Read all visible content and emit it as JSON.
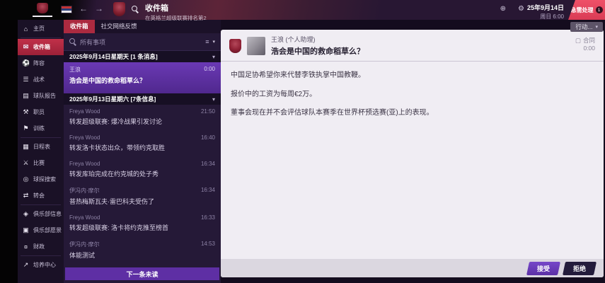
{
  "topbar": {
    "back": "←",
    "forward": "→",
    "title": "收件箱",
    "subtitle": "在英格兰超级联赛排名第2",
    "world_glyph": "⊕",
    "gear_glyph": "⚙",
    "date_line1": "25年9月14日",
    "date_line2": "周日 6:00",
    "urgent": {
      "label": "急需处理",
      "count": "1"
    },
    "actions": "行动...",
    "caret": "▾"
  },
  "sidebar": {
    "items": [
      {
        "key": "home",
        "label": "主页",
        "glyph": "⌂",
        "group": 0,
        "selected": false
      },
      {
        "key": "inbox",
        "label": "收件箱",
        "glyph": "✉",
        "group": 1,
        "selected": true
      },
      {
        "key": "squad",
        "label": "阵容",
        "glyph": "⚽",
        "group": 1,
        "selected": false
      },
      {
        "key": "tactics",
        "label": "战术",
        "glyph": "☰",
        "group": 1,
        "selected": false
      },
      {
        "key": "team-report",
        "label": "球队报告",
        "glyph": "▤",
        "group": 1,
        "selected": false
      },
      {
        "key": "staff",
        "label": "职员",
        "glyph": "⚒",
        "group": 1,
        "selected": false
      },
      {
        "key": "training",
        "label": "训练",
        "glyph": "⚑",
        "group": 1,
        "selected": false
      },
      {
        "key": "schedule",
        "label": "日程表",
        "glyph": "▦",
        "group": 2,
        "selected": false
      },
      {
        "key": "competitions",
        "label": "比赛",
        "glyph": "⚔",
        "group": 2,
        "selected": false
      },
      {
        "key": "scouting",
        "label": "球探搜索",
        "glyph": "◎",
        "group": 2,
        "selected": false
      },
      {
        "key": "transfers",
        "label": "转会",
        "glyph": "⇄",
        "group": 2,
        "selected": false
      },
      {
        "key": "club-info",
        "label": "俱乐部信息",
        "glyph": "◈",
        "group": 3,
        "selected": false
      },
      {
        "key": "club-vision",
        "label": "俱乐部愿景",
        "glyph": "▣",
        "group": 3,
        "selected": false
      },
      {
        "key": "finances",
        "label": "财政",
        "glyph": "¤",
        "group": 3,
        "selected": false
      },
      {
        "key": "development-centre",
        "label": "培养中心",
        "glyph": "↗",
        "group": 4,
        "selected": false
      }
    ]
  },
  "mail": {
    "tabs": [
      {
        "key": "inbox",
        "label": "收件箱",
        "active": true
      },
      {
        "key": "social",
        "label": "社交网络反馈",
        "active": false
      }
    ],
    "search_label": "所有事项",
    "view_glyph": "≡",
    "caret": "▾",
    "sections": [
      {
        "header": "2025年9月14日星期天 [1 条消息]",
        "items": [
          {
            "sender": "王浪",
            "time": "0:00",
            "subject": "浩会是中国的救命稻草么？",
            "selected": true
          }
        ]
      },
      {
        "header": "2025年9月13日星期六 [7条信息]",
        "items": [
          {
            "sender": "Freya Wood",
            "time": "21:50",
            "subject": "转发超级联赛: 爆冷战果引发讨论",
            "selected": false
          },
          {
            "sender": "Freya Wood",
            "time": "16:40",
            "subject": "转发洛卡状态出众，带领约克取胜",
            "selected": false
          },
          {
            "sender": "Freya Wood",
            "time": "16:34",
            "subject": "转发库珀完成在约克城的处子秀",
            "selected": false
          },
          {
            "sender": "伊冯内·摩尔",
            "time": "16:34",
            "subject": "普热梅斯瓦夫·雷巴科夫受伤了",
            "selected": false
          },
          {
            "sender": "Freya Wood",
            "time": "16:33",
            "subject": "转发超级联赛: 洛卡将约克推至榜首",
            "selected": false
          },
          {
            "sender": "伊冯内·摩尔",
            "time": "14:53",
            "subject": "体能测试",
            "selected": false
          }
        ]
      }
    ],
    "next_unread": "下一条未读"
  },
  "message": {
    "sender": "王浪 (个人助理)",
    "subject": "浩会是中国的救命稻草么？",
    "tag_glyph": "▢",
    "tag": "合同",
    "time": "0:00",
    "paragraphs": [
      "中国足协希望你来代替李铁执掌中国教鞭。",
      "报价中的工资为每周€2万。",
      "董事会现在并不会评估球队本赛季在世界杯预选赛(亚)上的表现。"
    ],
    "accept": "接受",
    "reject": "拒绝"
  },
  "colors": {
    "accent_red": "#ac2a40",
    "accent_purple": "#5e2fa4",
    "urgent_red": "#e84a5f"
  }
}
